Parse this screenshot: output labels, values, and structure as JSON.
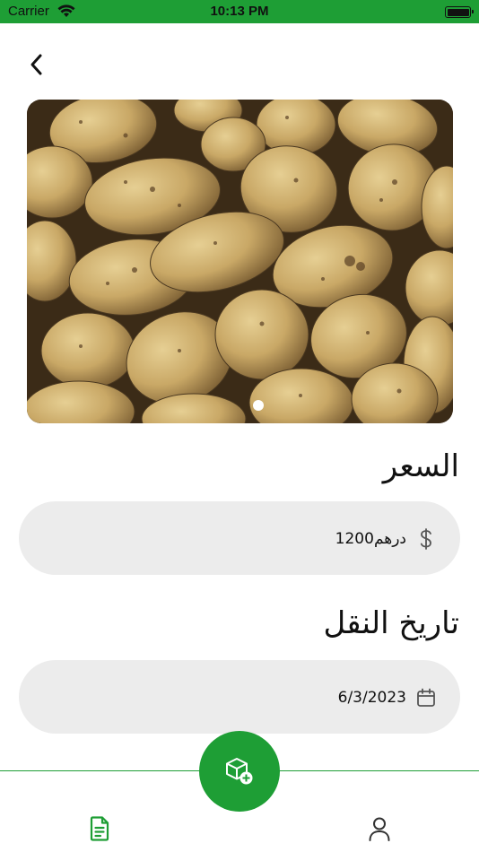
{
  "status_bar": {
    "carrier": "Carrier",
    "time": "10:13 PM",
    "color": "#1e9e35"
  },
  "header": {
    "back_icon": "chevron-left-icon"
  },
  "product": {
    "image_alt": "potatoes",
    "carousel_active_index": 0
  },
  "price": {
    "title": "السعر",
    "icon": "dollar-icon",
    "value": "1200درهم"
  },
  "transfer_date": {
    "title": "تاريخ النقل",
    "icon": "calendar-icon",
    "value": "6/3/2023"
  },
  "bottom_nav": {
    "accent": "#1e9e35",
    "items": [
      {
        "name": "orders",
        "icon": "document-icon",
        "active": true
      },
      {
        "name": "add-product",
        "icon": "box-add-icon"
      },
      {
        "name": "profile",
        "icon": "user-icon"
      }
    ]
  }
}
